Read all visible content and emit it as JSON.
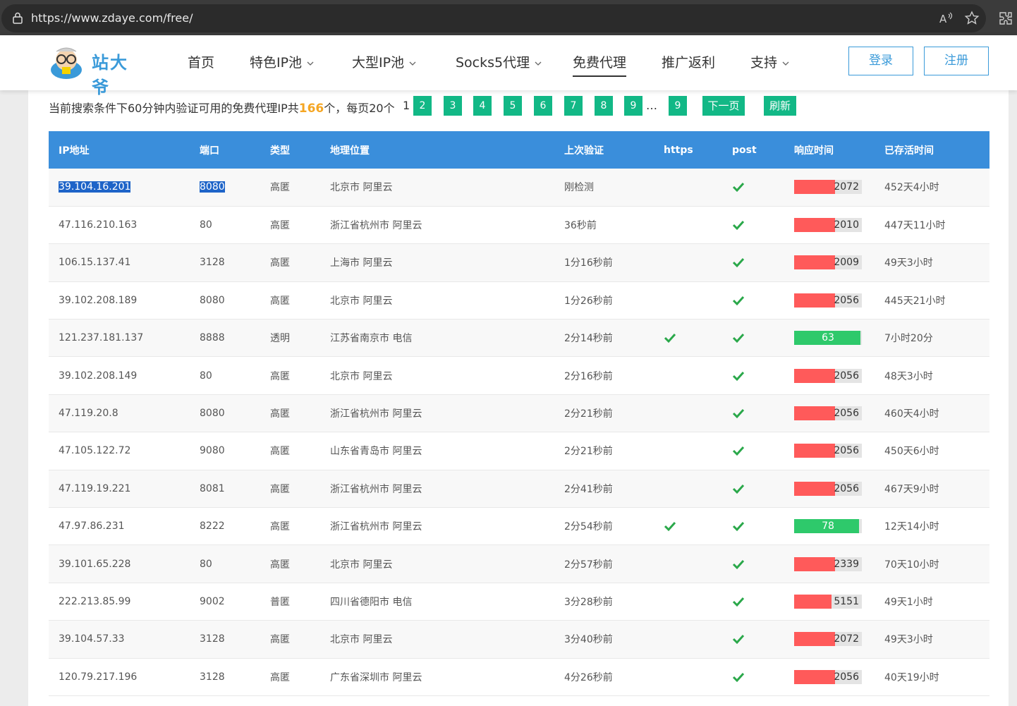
{
  "browser": {
    "url": "https://www.zdaye.com/free/"
  },
  "nav": {
    "logo_text": "站大爷",
    "items": [
      "首页",
      "特色IP池",
      "大型IP池",
      "Socks5代理",
      "免费代理",
      "推广返利",
      "支持"
    ],
    "login": "登录",
    "register": "注册"
  },
  "summary": {
    "prefix": "当前搜索条件下60分钟内验证可用的免费代理IP共",
    "count": "166",
    "suffix": "个，每页20个",
    "current_page": "1",
    "pages": [
      "2",
      "3",
      "4",
      "5",
      "6",
      "7",
      "8",
      "9"
    ],
    "ellipsis": "…",
    "last": "9",
    "next": "下一页",
    "refresh": "刷新"
  },
  "table": {
    "headers": [
      "IP地址",
      "端口",
      "类型",
      "地理位置",
      "上次验证",
      "https",
      "post",
      "响应时间",
      "已存活时间"
    ],
    "rows": [
      {
        "ip": "39.104.16.201",
        "port": "8080",
        "type": "高匿",
        "loc": "北京市 阿里云",
        "verify": "刚检测",
        "https": false,
        "post": true,
        "resp": "2072",
        "fast": false,
        "fill": 0.6,
        "alive": "452天4小时"
      },
      {
        "ip": "47.116.210.163",
        "port": "80",
        "type": "高匿",
        "loc": "浙江省杭州市 阿里云",
        "verify": "36秒前",
        "https": false,
        "post": true,
        "resp": "2010",
        "fast": false,
        "fill": 0.6,
        "alive": "447天11小时"
      },
      {
        "ip": "106.15.137.41",
        "port": "3128",
        "type": "高匿",
        "loc": "上海市 阿里云",
        "verify": "1分16秒前",
        "https": false,
        "post": true,
        "resp": "2009",
        "fast": false,
        "fill": 0.6,
        "alive": "49天3小时"
      },
      {
        "ip": "39.102.208.189",
        "port": "8080",
        "type": "高匿",
        "loc": "北京市 阿里云",
        "verify": "1分26秒前",
        "https": false,
        "post": true,
        "resp": "2056",
        "fast": false,
        "fill": 0.6,
        "alive": "445天21小时"
      },
      {
        "ip": "121.237.181.137",
        "port": "8888",
        "type": "透明",
        "loc": "江苏省南京市 电信",
        "verify": "2分14秒前",
        "https": true,
        "post": true,
        "resp": "63",
        "fast": true,
        "fill": 0.98,
        "alive": "7小时20分"
      },
      {
        "ip": "39.102.208.149",
        "port": "80",
        "type": "高匿",
        "loc": "北京市 阿里云",
        "verify": "2分16秒前",
        "https": false,
        "post": true,
        "resp": "2056",
        "fast": false,
        "fill": 0.6,
        "alive": "48天3小时"
      },
      {
        "ip": "47.119.20.8",
        "port": "8080",
        "type": "高匿",
        "loc": "浙江省杭州市 阿里云",
        "verify": "2分21秒前",
        "https": false,
        "post": true,
        "resp": "2056",
        "fast": false,
        "fill": 0.6,
        "alive": "460天4小时"
      },
      {
        "ip": "47.105.122.72",
        "port": "9080",
        "type": "高匿",
        "loc": "山东省青岛市 阿里云",
        "verify": "2分21秒前",
        "https": false,
        "post": true,
        "resp": "2056",
        "fast": false,
        "fill": 0.6,
        "alive": "450天6小时"
      },
      {
        "ip": "47.119.19.221",
        "port": "8081",
        "type": "高匿",
        "loc": "浙江省杭州市 阿里云",
        "verify": "2分41秒前",
        "https": false,
        "post": true,
        "resp": "2056",
        "fast": false,
        "fill": 0.6,
        "alive": "467天9小时"
      },
      {
        "ip": "47.97.86.231",
        "port": "8222",
        "type": "高匿",
        "loc": "浙江省杭州市 阿里云",
        "verify": "2分54秒前",
        "https": true,
        "post": true,
        "resp": "78",
        "fast": true,
        "fill": 0.96,
        "alive": "12天14小时"
      },
      {
        "ip": "39.101.65.228",
        "port": "80",
        "type": "高匿",
        "loc": "北京市 阿里云",
        "verify": "2分57秒前",
        "https": false,
        "post": true,
        "resp": "2339",
        "fast": false,
        "fill": 0.6,
        "alive": "70天10小时"
      },
      {
        "ip": "222.213.85.99",
        "port": "9002",
        "type": "普匿",
        "loc": "四川省德阳市 电信",
        "verify": "3分28秒前",
        "https": false,
        "post": true,
        "resp": "5151",
        "fast": false,
        "fill": 0.55,
        "alive": "49天1小时"
      },
      {
        "ip": "39.104.57.33",
        "port": "3128",
        "type": "高匿",
        "loc": "北京市 阿里云",
        "verify": "3分40秒前",
        "https": false,
        "post": true,
        "resp": "2072",
        "fast": false,
        "fill": 0.6,
        "alive": "49天3小时"
      },
      {
        "ip": "120.79.217.196",
        "port": "3128",
        "type": "高匿",
        "loc": "广东省深圳市 阿里云",
        "verify": "4分26秒前",
        "https": false,
        "post": true,
        "resp": "2056",
        "fast": false,
        "fill": 0.6,
        "alive": "40天19小时"
      }
    ]
  },
  "colors": {
    "accent": "#3a8edb",
    "green": "#12b886",
    "slow": "#ff5a5a",
    "fast": "#2ec96b",
    "count": "#f5a623"
  }
}
